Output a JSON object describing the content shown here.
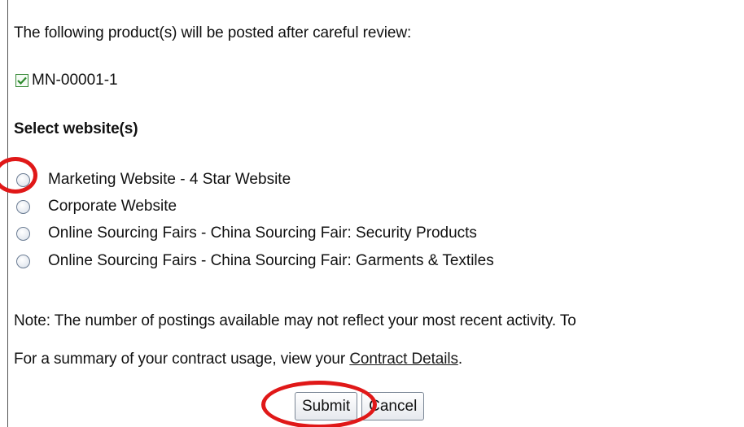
{
  "intro": {
    "text": "The following product(s) will be posted after careful review:"
  },
  "product": {
    "checked": true,
    "label": "MN-00001-1"
  },
  "website_section": {
    "heading": "Select website(s)",
    "options": [
      {
        "label": "Marketing Website - 4 Star Website",
        "selected": false
      },
      {
        "label": "Corporate Website",
        "selected": false
      },
      {
        "label": "Online Sourcing Fairs - China Sourcing Fair: Security Products",
        "selected": false
      },
      {
        "label": "Online Sourcing Fairs - China Sourcing Fair: Garments & Textiles",
        "selected": false
      }
    ]
  },
  "note": {
    "text": "Note: The number of postings available may not reflect your most recent activity. To"
  },
  "summary": {
    "prefix": "For a summary of your contract usage, view your ",
    "link_text": "Contract Details",
    "suffix": "."
  },
  "actions": {
    "submit_label": "Submit",
    "cancel_label": "Cancel"
  },
  "colors": {
    "annotation": "#e01818",
    "checkbox_check": "#2e8b2e"
  },
  "icons": {
    "checkbox": "checkbox-checked-icon",
    "radio": "radio-unselected-icon"
  }
}
